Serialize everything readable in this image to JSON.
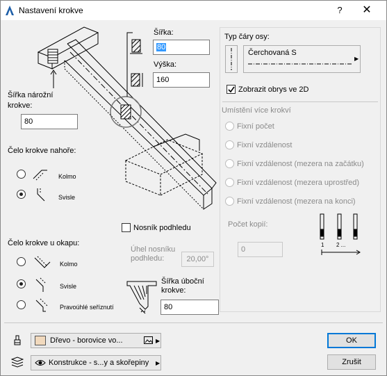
{
  "window": {
    "title": "Nastavení krokve",
    "help_label": "?",
    "close_label": "✕"
  },
  "size": {
    "width_label": "Šířka:",
    "width_value": "80",
    "height_label": "Výška:",
    "height_value": "160",
    "corner_width_label_1": "Šířka nárožní",
    "corner_width_label_2": "krokve:",
    "corner_width_value": "80"
  },
  "top_end": {
    "heading": "Čelo krokve nahoře:",
    "options": [
      {
        "label": "Kolmo",
        "selected": false
      },
      {
        "label": "Svisle",
        "selected": true
      }
    ]
  },
  "eave_end": {
    "heading": "Čelo krokve u okapu:",
    "options": [
      {
        "label": "Kolmo",
        "selected": false
      },
      {
        "label": "Svisle",
        "selected": true
      },
      {
        "label": "Pravoúhlé seříznutí",
        "selected": false
      }
    ]
  },
  "soffit": {
    "checkbox_label": "Nosník podhledu",
    "checked": false,
    "angle_label_1": "Úhel nosníku",
    "angle_label_2": "podhledu:",
    "angle_value": "20,00°",
    "side_width_label_1": "Šířka úboční",
    "side_width_label_2": "krokve:",
    "side_width_value": "80"
  },
  "axis": {
    "heading": "Typ čáry osy:",
    "line_type": "Čerchovaná S",
    "show_outline_label": "Zobrazit obrys ve 2D",
    "show_outline_checked": true
  },
  "multiple": {
    "heading": "Umístění více krokví",
    "options": [
      "Fixní počet",
      "Fixní vzdálenost",
      "Fixní vzdálenost (mezera na začátku)",
      "Fixní vzdálenost (mezera uprostřed)",
      "Fixní vzdálenost (mezera na konci)"
    ],
    "copies_label": "Počet kopií:",
    "copies_value": "0",
    "preview_labels": [
      "1",
      "2 ..."
    ]
  },
  "bottom": {
    "material": "Dřevo - borovice vo...",
    "material_swatch": "#f1d9bd",
    "layer": "Konstrukce - s...y a skořepiny",
    "ok_label": "OK",
    "cancel_label": "Zrušit"
  }
}
